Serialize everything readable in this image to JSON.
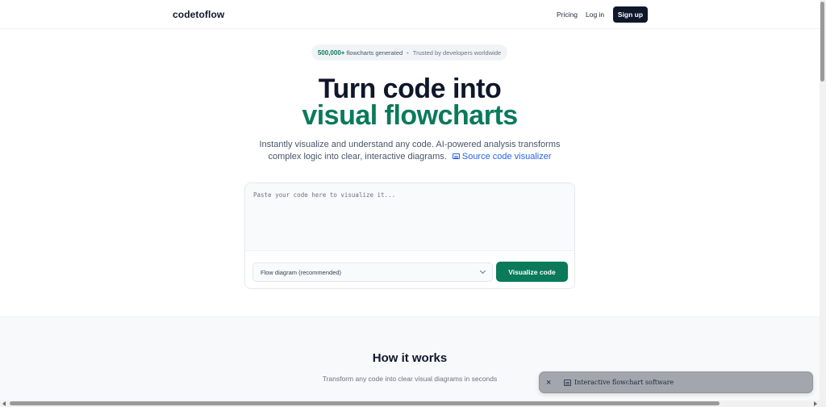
{
  "header": {
    "logo": "codetoflow",
    "nav": {
      "pricing": "Pricing",
      "login": "Log in",
      "signup": "Sign up"
    }
  },
  "hero": {
    "badge": {
      "count": "500,000+",
      "count_label": "flowcharts generated",
      "separator": "•",
      "trusted": "Trusted by developers worldwide"
    },
    "title_line1": "Turn code into",
    "title_line2": "visual flowcharts",
    "subtitle_line1": "Instantly visualize and understand any code. AI-powered analysis transforms",
    "subtitle_line2": "complex logic into clear, interactive diagrams.",
    "subtitle_link": "Source code visualizer",
    "subtitle_link_icon": "diagram-icon"
  },
  "editor": {
    "placeholder": "Paste your code here to visualize it...",
    "value": "",
    "diagram_type": "Flow diagram (recommended)",
    "visualize_label": "Visualize code"
  },
  "how_it_works": {
    "title": "How it works",
    "subtitle": "Transform any code into clear visual diagrams in seconds"
  },
  "toast": {
    "close_icon": "×",
    "icon": "diagram-icon",
    "text": "Interactive flowchart software"
  },
  "colors": {
    "accent": "#0a7a5a",
    "dark": "#0f172a",
    "link": "#2563eb"
  }
}
